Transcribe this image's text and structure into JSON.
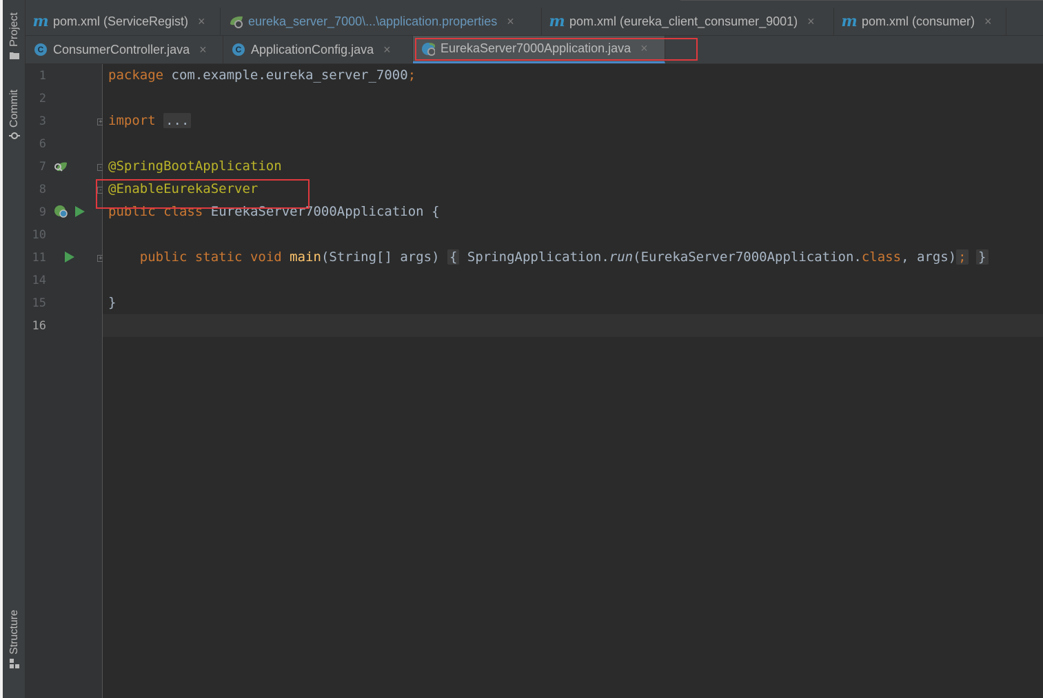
{
  "left_tools": {
    "project": "Project",
    "commit": "Commit",
    "structure": "Structure"
  },
  "tabs_row1": [
    {
      "icon": "m",
      "label": "pom.xml (ServiceRegist)"
    },
    {
      "icon": "spring-properties",
      "label": "eureka_server_7000\\...\\application.properties"
    },
    {
      "icon": "m",
      "label": "pom.xml (eureka_client_consumer_9001)"
    },
    {
      "icon": "m",
      "label": "pom.xml (consumer)"
    }
  ],
  "tabs_row2": [
    {
      "icon": "C",
      "label": "ConsumerController.java"
    },
    {
      "icon": "C",
      "label": "ApplicationConfig.java"
    },
    {
      "icon": "spring-class",
      "label": "EurekaServer7000Application.java",
      "active": true
    }
  ],
  "close_glyph": "×",
  "code_lines": [
    {
      "no": "1"
    },
    {
      "no": "2"
    },
    {
      "no": "3"
    },
    {
      "no": "6"
    },
    {
      "no": "7"
    },
    {
      "no": "8"
    },
    {
      "no": "9"
    },
    {
      "no": "10"
    },
    {
      "no": "11"
    },
    {
      "no": "14"
    },
    {
      "no": "15"
    },
    {
      "no": "16",
      "current": true
    }
  ],
  "code": {
    "package_kw": "package",
    "package_name": " com.example.eureka_server_7000",
    "semicolon": ";",
    "import_kw": "import",
    "import_folded": "...",
    "annotation1": "@SpringBootApplication",
    "annotation2": "@EnableEurekaServer",
    "public_kw": "public",
    "class_kw": "class",
    "class_name": "EurekaServer7000Application",
    "open_brace": "{",
    "static_kw": "static",
    "void_kw": "void",
    "main_fn": "main",
    "main_params": "(String[] args)",
    "main_body_prefix": "SpringApplication.",
    "run_fn": "run",
    "main_body_args_open": "(EurekaServer7000Application.",
    "class_literal": "class",
    "main_body_args_close": ", args)",
    "close_brace": "}"
  },
  "colors": {
    "keyword": "#cc7832",
    "annotation": "#bbb529",
    "function": "#ffc66d",
    "plain": "#a9b7c6",
    "highlight_box": "#e0393e"
  }
}
